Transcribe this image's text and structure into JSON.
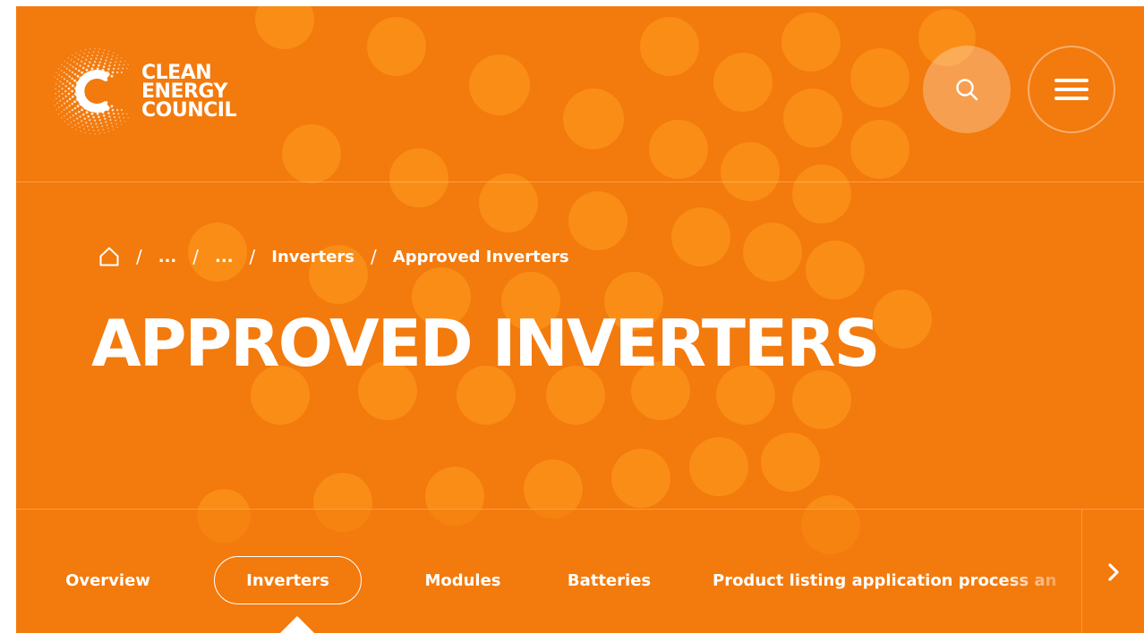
{
  "brand": {
    "logo_lines": [
      "CLEAN",
      "ENERGY",
      "COUNCIL"
    ],
    "accent": "#f37a0d",
    "dot_color": "#ff9d1f"
  },
  "header": {
    "search_icon": "search-icon",
    "menu_icon": "hamburger-menu-icon"
  },
  "breadcrumb": {
    "home_icon": "home-icon",
    "items": [
      "...",
      "...",
      "Inverters",
      "Approved Inverters"
    ],
    "separator": "/"
  },
  "page": {
    "title": "APPROVED INVERTERS"
  },
  "tabs": {
    "items": [
      {
        "label": "Overview",
        "active": false
      },
      {
        "label": "Inverters",
        "active": true
      },
      {
        "label": "Modules",
        "active": false
      },
      {
        "label": "Batteries",
        "active": false
      },
      {
        "label": "Product listing application process an",
        "active": false
      }
    ],
    "next_icon": "chevron-right-icon"
  }
}
